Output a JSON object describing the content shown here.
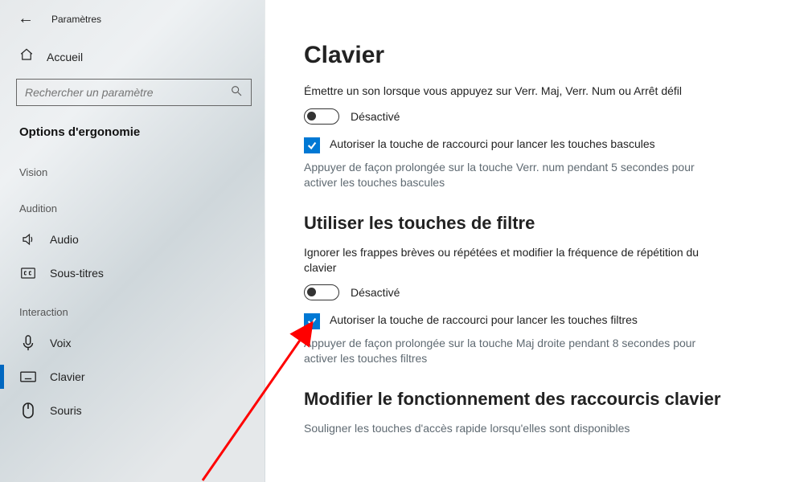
{
  "window": {
    "title": "Paramètres"
  },
  "sidebar": {
    "home": "Accueil",
    "search_placeholder": "Rechercher un paramètre",
    "section": "Options d'ergonomie",
    "groups": [
      {
        "label": "Vision",
        "items": []
      },
      {
        "label": "Audition",
        "items": [
          {
            "key": "audio",
            "label": "Audio",
            "icon": "volume-icon"
          },
          {
            "key": "subtitles",
            "label": "Sous-titres",
            "icon": "cc-icon"
          }
        ]
      },
      {
        "label": "Interaction",
        "items": [
          {
            "key": "voice",
            "label": "Voix",
            "icon": "mic-icon"
          },
          {
            "key": "keyboard",
            "label": "Clavier",
            "icon": "keyboard-icon",
            "selected": true
          },
          {
            "key": "mouse",
            "label": "Souris",
            "icon": "mouse-icon"
          }
        ]
      }
    ]
  },
  "main": {
    "title": "Clavier",
    "sec1": {
      "desc": "Émettre un son lorsque vous appuyez sur Verr. Maj, Verr. Num ou Arrêt défil",
      "toggle": {
        "state": "Désactivé",
        "on": false
      },
      "check": {
        "label": "Autoriser la touche de raccourci pour lancer les touches bascules",
        "checked": true
      },
      "hint": "Appuyer de façon prolongée sur la touche Verr. num pendant 5 secondes pour activer les touches bascules"
    },
    "sec2": {
      "heading": "Utiliser les touches de filtre",
      "desc": "Ignorer les frappes brèves ou répétées et modifier la fréquence de répétition du clavier",
      "toggle": {
        "state": "Désactivé",
        "on": false
      },
      "check": {
        "label": "Autoriser la touche de raccourci pour lancer les touches filtres",
        "checked": true
      },
      "hint": "Appuyer de façon prolongée sur la touche Maj droite pendant 8 secondes pour activer les touches filtres"
    },
    "sec3": {
      "heading": "Modifier le fonctionnement des raccourcis clavier",
      "hint": "Souligner les touches d'accès rapide lorsqu'elles sont disponibles"
    }
  }
}
